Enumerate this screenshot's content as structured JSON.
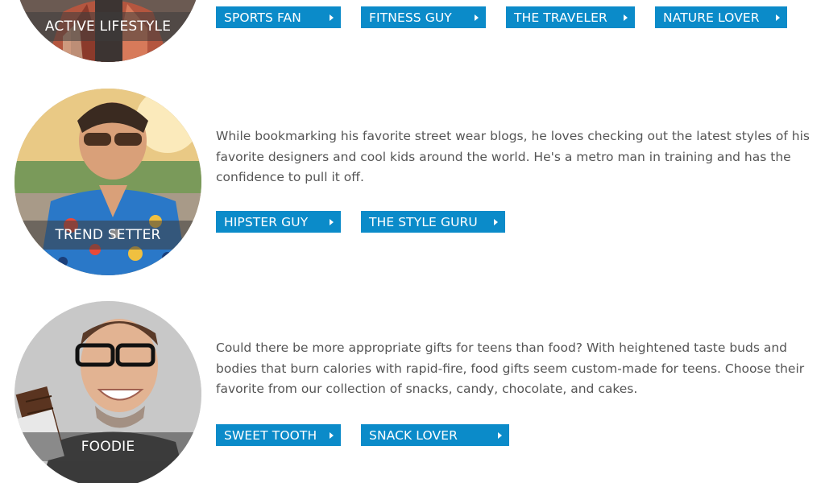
{
  "accent_color": "#0b8bc9",
  "sections": [
    {
      "label": "ACTIVE LIFESTYLE",
      "description": "",
      "buttons": [
        "SPORTS FAN",
        "FITNESS GUY",
        "THE TRAVELER",
        "NATURE LOVER"
      ]
    },
    {
      "label": "TREND SETTER",
      "description": "While bookmarking his favorite street wear blogs, he loves checking out the latest styles of his favorite designers and cool kids around the world. He's a metro man in training and has the confidence to pull it off.",
      "buttons": [
        "HIPSTER GUY",
        "THE STYLE GURU"
      ]
    },
    {
      "label": "FOODIE",
      "description": "Could there be more appropriate gifts for teens than food? With heightened taste buds and bodies that burn calories with rapid-fire, food gifts seem custom-made for teens. Choose their favorite from our collection of snacks, candy, chocolate, and cakes.",
      "buttons": [
        "SWEET TOOTH",
        "SNACK LOVER"
      ]
    }
  ]
}
